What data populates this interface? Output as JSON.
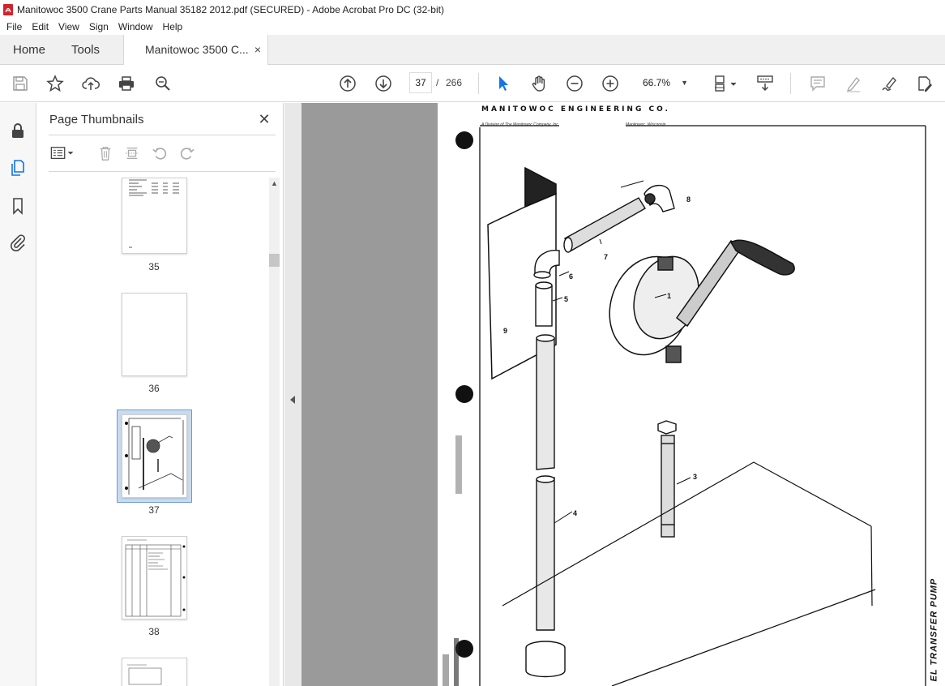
{
  "window": {
    "title": "Manitowoc 3500 Crane Parts Manual 35182 2012.pdf (SECURED) - Adobe Acrobat Pro DC (32-bit)"
  },
  "menu": [
    "File",
    "Edit",
    "View",
    "Sign",
    "Window",
    "Help"
  ],
  "tabs": {
    "home": "Home",
    "tools": "Tools",
    "document": "Manitowoc 3500 C...",
    "close": "×"
  },
  "toolbar": {
    "current_page": "37",
    "separator": "/",
    "total_pages": "266",
    "zoom": "66.7%"
  },
  "thumbnails_panel": {
    "title": "Page Thumbnails",
    "close": "✕",
    "pages": [
      {
        "label": "35"
      },
      {
        "label": "36"
      },
      {
        "label": "37",
        "selected": true
      },
      {
        "label": "38"
      }
    ]
  },
  "document": {
    "header": "MANITOWOC ENGINEERING CO.",
    "sub_left": "A Division of The Manitowoc Company, Inc.",
    "sub_right": "Manitowoc, Wisconsin",
    "side_title": "EL TRANSFER PUMP",
    "part_numbers": [
      "1",
      "3",
      "4",
      "5",
      "6",
      "7",
      "8",
      "9"
    ]
  },
  "colors": {
    "accent": "#1473e6",
    "acrobat_red": "#d2232a",
    "panel_bg": "#f7f7f7",
    "doc_bg": "#9a9a9a",
    "selection": "#c9dcef"
  }
}
